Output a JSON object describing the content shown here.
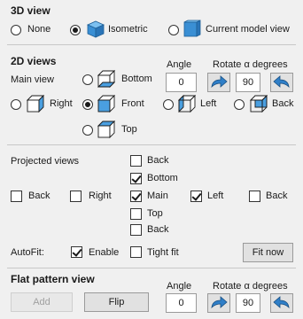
{
  "view3d": {
    "title": "3D view",
    "options": [
      {
        "label": "None",
        "checked": false
      },
      {
        "label": "Isometric",
        "checked": true
      },
      {
        "label": "Current model view",
        "checked": false
      }
    ]
  },
  "views2d": {
    "title": "2D views",
    "main_view_label": "Main view",
    "angle_label": "Angle",
    "angle_value": "0",
    "rotate_label": "Rotate α degrees",
    "rotate_value": "90",
    "options": {
      "bottom": "Bottom",
      "right": "Right",
      "front": "Front",
      "left": "Left",
      "back": "Back",
      "top": "Top"
    },
    "selected": "Front"
  },
  "projected": {
    "label": "Projected views",
    "items": {
      "back_top": {
        "label": "Back",
        "checked": false
      },
      "bottom": {
        "label": "Bottom",
        "checked": true
      },
      "back_left": {
        "label": "Back",
        "checked": false
      },
      "right": {
        "label": "Right",
        "checked": false
      },
      "main": {
        "label": "Main",
        "checked": true
      },
      "left": {
        "label": "Left",
        "checked": true
      },
      "back_right": {
        "label": "Back",
        "checked": false
      },
      "top": {
        "label": "Top",
        "checked": false
      },
      "back_bottom": {
        "label": "Back",
        "checked": false
      }
    }
  },
  "autofit": {
    "label": "AutoFit:",
    "enable_label": "Enable",
    "enable_checked": true,
    "tight_label": "Tight fit",
    "tight_checked": false,
    "fit_now": "Fit now"
  },
  "flat": {
    "title": "Flat pattern view",
    "add_label": "Add",
    "flip_label": "Flip",
    "angle_label": "Angle",
    "angle_value": "0",
    "rotate_label": "Rotate α degrees",
    "rotate_value": "90"
  },
  "colors": {
    "accent_blue": "#2f7fc8",
    "cube_face": "#4a9fe0",
    "background": "#f0f0f0"
  }
}
